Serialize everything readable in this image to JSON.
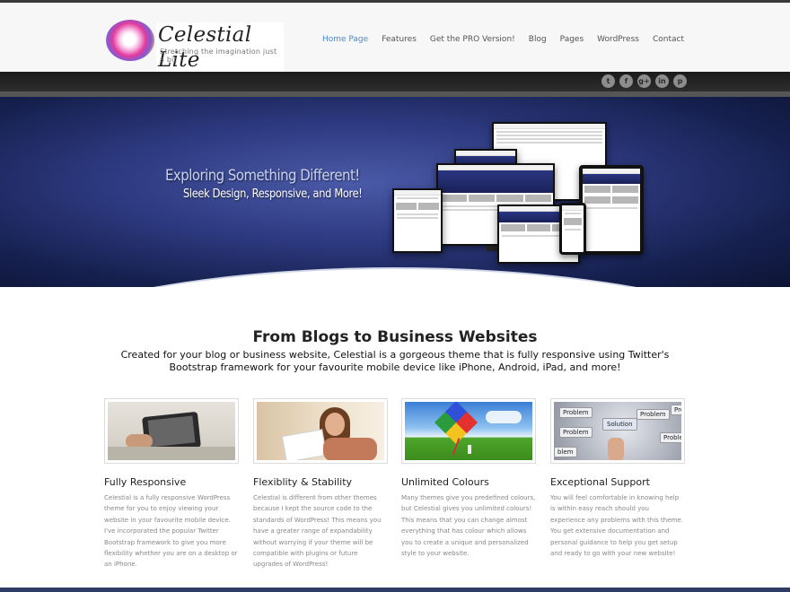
{
  "brand": {
    "title": "Celestial Lite",
    "tagline": "Stretching the imagination just a bit"
  },
  "nav": {
    "items": [
      "Home Page",
      "Features",
      "Get the PRO Version!",
      "Blog",
      "Pages",
      "WordPress",
      "Contact"
    ],
    "active": "Home Page",
    "active_color": "#4f87c7"
  },
  "social": {
    "icons": [
      "twitter-icon",
      "facebook-icon",
      "google-plus-icon",
      "linkedin-icon",
      "pinterest-icon"
    ],
    "glyphs": [
      "t",
      "f",
      "g+",
      "in",
      "p"
    ]
  },
  "hero": {
    "headline": "Exploring Something Different!",
    "subheadline": "Sleek Design, Responsive, and More!"
  },
  "intro": {
    "title": "From Blogs to Business Websites",
    "text": "Created for your blog or business website, Celestial is a gorgeous theme that is fully responsive using Twitter's Bootstrap framework for your favourite mobile device like iPhone, Android, iPad, and more!"
  },
  "features": [
    {
      "title": "Fully Responsive",
      "text": "Celestial is a fully responsive WordPress theme for you to enjoy viewing your website in your favourite mobile device. I've incorporated the popular Twitter Bootstrap framework to give you more flexibility whether you are on a desktop or an iPhone."
    },
    {
      "title": "Flexiblity & Stability",
      "text": "Celestial is different from other themes because I kept the source code to the standards of WordPress! This means you have a greater range of expandability without worrying if your theme will be compatible with plugins or future upgrades of WordPress!"
    },
    {
      "title": "Unlimited Colours",
      "text": "Many themes give you predefined colours, but Celestial gives you unlimited colours! This means that you can change almost everything that has colour which allows you to create a unique and personalized style to your website."
    },
    {
      "title": "Exceptional Support",
      "text": "You will feel comfortable in knowing help is within easy reach should you experience any problems with this theme. You get extensive documentation and personal guidance to help you get setup and ready to go with your new website!"
    }
  ],
  "support_image": {
    "labels": [
      "Problem",
      "Solution",
      "Problem",
      "Problem",
      "Problem",
      "Pro",
      "blem"
    ]
  }
}
